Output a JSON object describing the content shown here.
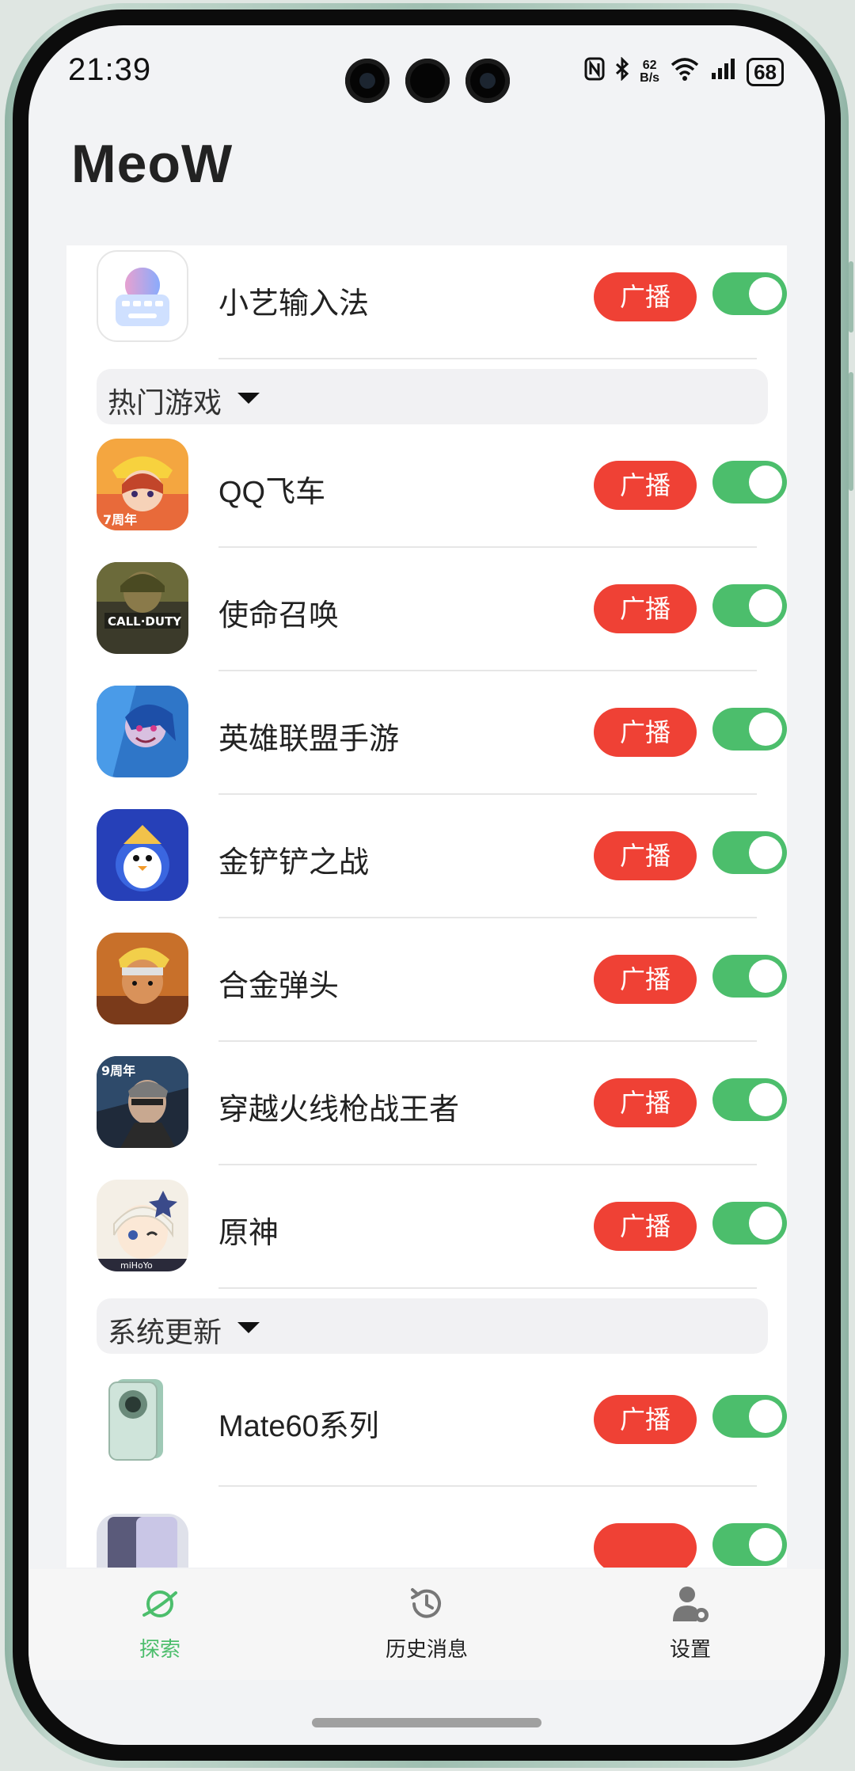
{
  "status_bar": {
    "time": "21:39",
    "net_speed_value": "62",
    "net_speed_unit": "B/s",
    "battery": "68",
    "icons": [
      "nfc-icon",
      "bluetooth-icon",
      "wifi-icon",
      "signal-icon",
      "battery-icon"
    ]
  },
  "header": {
    "title": "MeoW"
  },
  "colors": {
    "accent": "#4cbe6c",
    "broadcast": "#ef4135",
    "background": "#f2f3f5"
  },
  "list": {
    "broadcast_label": "广播",
    "top_item": {
      "name": "小艺输入法",
      "icon": "xiaoyi-input-icon",
      "enabled": true
    },
    "sections": [
      {
        "title": "热门游戏",
        "items": [
          {
            "name": "QQ飞车",
            "icon": "qq-speed-icon",
            "enabled": true
          },
          {
            "name": "使命召唤",
            "icon": "call-of-duty-icon",
            "enabled": true
          },
          {
            "name": "英雄联盟手游",
            "icon": "league-of-legends-icon",
            "enabled": true
          },
          {
            "name": "金铲铲之战",
            "icon": "golden-spatula-icon",
            "enabled": true
          },
          {
            "name": "合金弹头",
            "icon": "metal-slug-icon",
            "enabled": true
          },
          {
            "name": "穿越火线枪战王者",
            "icon": "crossfire-icon",
            "enabled": true
          },
          {
            "name": "原神",
            "icon": "genshin-icon",
            "enabled": true
          }
        ]
      },
      {
        "title": "系统更新",
        "items": [
          {
            "name": "Mate60系列",
            "icon": "mate60-phone-icon",
            "enabled": true
          }
        ]
      }
    ]
  },
  "bottom_nav": {
    "items": [
      {
        "label": "探索",
        "icon": "planet-icon",
        "active": true
      },
      {
        "label": "历史消息",
        "icon": "history-icon",
        "active": false
      },
      {
        "label": "设置",
        "icon": "user-settings-icon",
        "active": false
      }
    ]
  }
}
